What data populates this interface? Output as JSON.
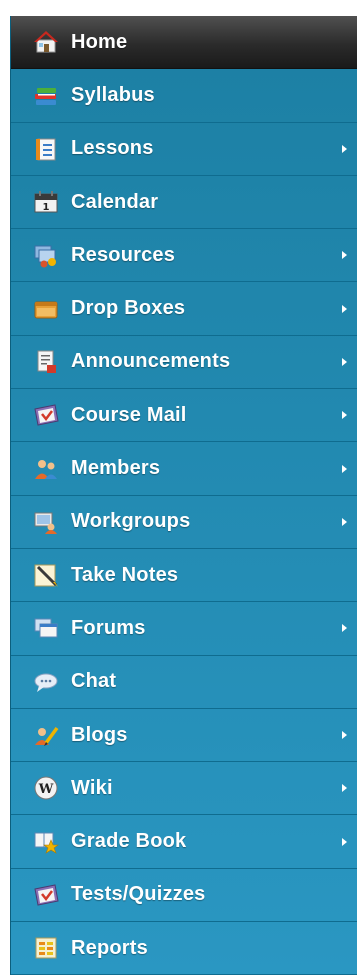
{
  "menu": {
    "items": [
      {
        "label": "Home",
        "icon": "home-icon",
        "has_submenu": false,
        "active": true
      },
      {
        "label": "Syllabus",
        "icon": "books-icon",
        "has_submenu": false
      },
      {
        "label": "Lessons",
        "icon": "notebook-icon",
        "has_submenu": true
      },
      {
        "label": "Calendar",
        "icon": "calendar-icon",
        "has_submenu": false
      },
      {
        "label": "Resources",
        "icon": "resources-icon",
        "has_submenu": true
      },
      {
        "label": "Drop Boxes",
        "icon": "drop-box-icon",
        "has_submenu": true
      },
      {
        "label": "Announcements",
        "icon": "announcement-icon",
        "has_submenu": true
      },
      {
        "label": "Course Mail",
        "icon": "mail-icon",
        "has_submenu": true
      },
      {
        "label": "Members",
        "icon": "members-icon",
        "has_submenu": true
      },
      {
        "label": "Workgroups",
        "icon": "workgroups-icon",
        "has_submenu": true
      },
      {
        "label": "Take Notes",
        "icon": "notes-icon",
        "has_submenu": false
      },
      {
        "label": "Forums",
        "icon": "forums-icon",
        "has_submenu": true
      },
      {
        "label": "Chat",
        "icon": "chat-icon",
        "has_submenu": false
      },
      {
        "label": "Blogs",
        "icon": "blog-icon",
        "has_submenu": true
      },
      {
        "label": "Wiki",
        "icon": "wiki-icon",
        "has_submenu": true
      },
      {
        "label": "Grade Book",
        "icon": "grade-book-icon",
        "has_submenu": true
      },
      {
        "label": "Tests/Quizzes",
        "icon": "quiz-icon",
        "has_submenu": false
      },
      {
        "label": "Reports",
        "icon": "reports-icon",
        "has_submenu": false
      }
    ]
  },
  "colors": {
    "menu_bg_top": "#1c7fa3",
    "menu_bg_bottom": "#2a97c2",
    "active_bg": "#2b2b2b",
    "text": "#ffffff"
  }
}
